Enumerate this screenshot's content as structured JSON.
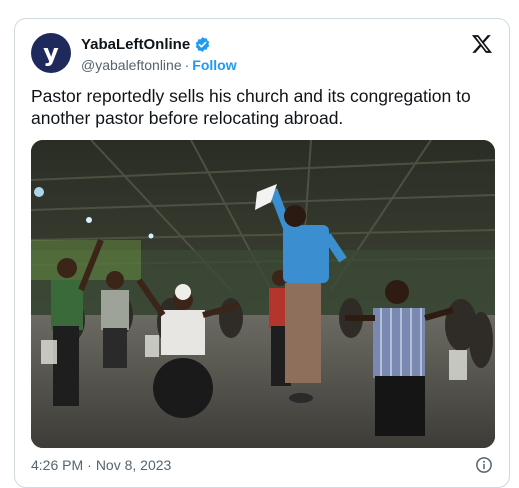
{
  "account": {
    "avatar_letter": "y",
    "display_name": "YabaLeftOnline",
    "handle": "@yabaleftonline",
    "separator": "·",
    "follow_label": "Follow"
  },
  "tweet": {
    "text": "Pastor reportedly sells his church and its congregation to another pastor before relocating abroad."
  },
  "media": {
    "description_icon": "photo"
  },
  "footer": {
    "time": "4:26 PM",
    "separator": "·",
    "date": "Nov 8, 2023"
  },
  "icons": {
    "brand": "x-logo-icon",
    "verified": "verified-badge-icon",
    "info": "info-icon"
  },
  "colors": {
    "accent": "#1d9bf0",
    "text": "#0f1419",
    "muted": "#536471",
    "border": "#cfd9de",
    "avatar_bg": "#1f2a5c"
  }
}
